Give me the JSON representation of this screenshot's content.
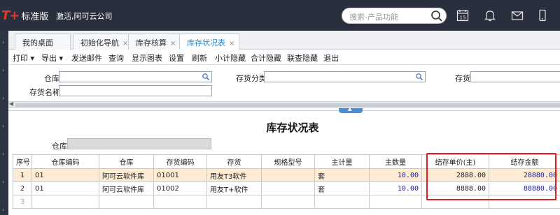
{
  "app": {
    "logo_text": "T+",
    "edition": "标准版",
    "company": "激活,阿可云公司",
    "search_placeholder": "搜索-产品功能",
    "calendar_day": "15"
  },
  "tabs": [
    {
      "label": "我的桌面",
      "closable": false,
      "active": false
    },
    {
      "label": "初始化导航",
      "closable": true,
      "active": false
    },
    {
      "label": "库存核算",
      "closable": true,
      "active": false
    },
    {
      "label": "库存状况表",
      "closable": true,
      "active": true
    }
  ],
  "tab_close_glyph": "×",
  "toolbar": [
    {
      "label": "打印",
      "dropdown": true
    },
    {
      "label": "导出",
      "dropdown": true
    },
    {
      "label": "发送邮件"
    },
    {
      "label": "查询"
    },
    {
      "label": "显示图表"
    },
    {
      "label": "设置"
    },
    {
      "label": "刷新"
    },
    {
      "label": "小计隐藏"
    },
    {
      "label": "合计隐藏"
    },
    {
      "label": "联查隐藏"
    },
    {
      "label": "退出"
    }
  ],
  "dropdown_glyph": "▾",
  "filter": {
    "warehouse_label": "仓库",
    "category_label": "存货分类",
    "inventory_label": "存货",
    "inventory_name_label": "存货名称"
  },
  "report": {
    "title": "库存状况表",
    "warehouse_label": "仓库",
    "columns": [
      "序号",
      "仓库编码",
      "仓库",
      "存货编码",
      "存货",
      "规格型号",
      "主计量",
      "主数量",
      "结存单价(主)",
      "结存金额"
    ],
    "rows": [
      {
        "idx": "1",
        "wh_code": "01",
        "wh": "阿可云软件库",
        "code": "01001",
        "name": "用友T3软件",
        "spec": "",
        "unit": "套",
        "qty": "10.00",
        "price": "2888.00",
        "amount": "28880.00"
      },
      {
        "idx": "2",
        "wh_code": "01",
        "wh": "阿可云软件库",
        "code": "01002",
        "name": "用友T+软件",
        "spec": "",
        "unit": "套",
        "qty": "10.00",
        "price": "8888.00",
        "amount": "88880.00"
      },
      {
        "idx": "3",
        "wh_code": "",
        "wh": "",
        "code": "",
        "name": "",
        "spec": "",
        "unit": "",
        "qty": "",
        "price": "",
        "amount": ""
      }
    ]
  },
  "colors": {
    "topbar": "#2a2f3d",
    "accent": "#2a87d0",
    "highlight_row": "#fdebd3",
    "annotation_box": "#e02020",
    "qty_text": "#1a1aa6"
  }
}
